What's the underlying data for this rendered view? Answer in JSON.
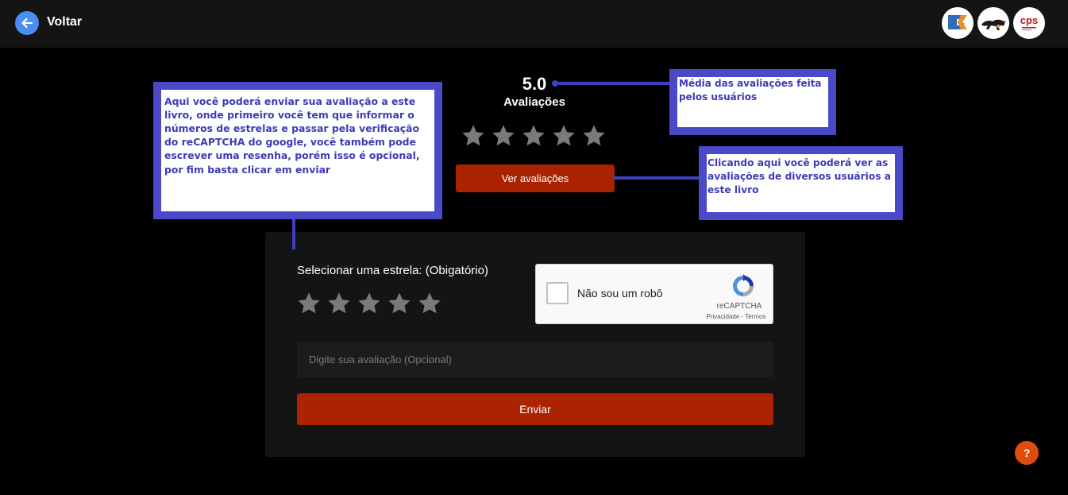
{
  "header": {
    "back_label": "Voltar",
    "logos": [
      {
        "name": "gk-logo-icon",
        "text": "GK",
        "color": "#2c6fb5"
      },
      {
        "name": "panther-logo-icon",
        "text": "",
        "color": "#222222"
      },
      {
        "name": "cps-logo-icon",
        "text": "cps",
        "color": "#c4161c"
      }
    ]
  },
  "rating": {
    "value": "5.0",
    "caption": "Avaliações",
    "stars_filled": 0,
    "stars_total": 5,
    "view_button": "Ver avaliações"
  },
  "form": {
    "star_label": "Selecionar uma estrela: (Obigatório)",
    "recaptcha": {
      "checkbox_label": "Não sou um robô",
      "brand": "reCAPTCHA",
      "links": "Privacidade - Termos"
    },
    "review_placeholder": "Digite sua avaliação (Opcional)",
    "send_button": "Enviar"
  },
  "help": {
    "label": "?"
  },
  "tutorial": {
    "form_hint": "Aqui você poderá enviar sua avaliação a este livro, onde primeiro você tem que informar o números de estrelas e passar pela verificação do reCAPTCHA do google, você também pode escrever uma resenha, porém isso é opcional, por fim basta clicar em enviar",
    "average_hint": "Média das avaliações feita pelos usuários",
    "view_hint": "Clicando aqui você poderá ver as avaliações de diversos usuários a este livro"
  },
  "colors": {
    "accent_button": "#ab2300",
    "back_button": "#4a8ef0",
    "star_empty": "#7a7a7a",
    "callout_border": "#4a49c8",
    "help_button": "#e24b0e"
  }
}
